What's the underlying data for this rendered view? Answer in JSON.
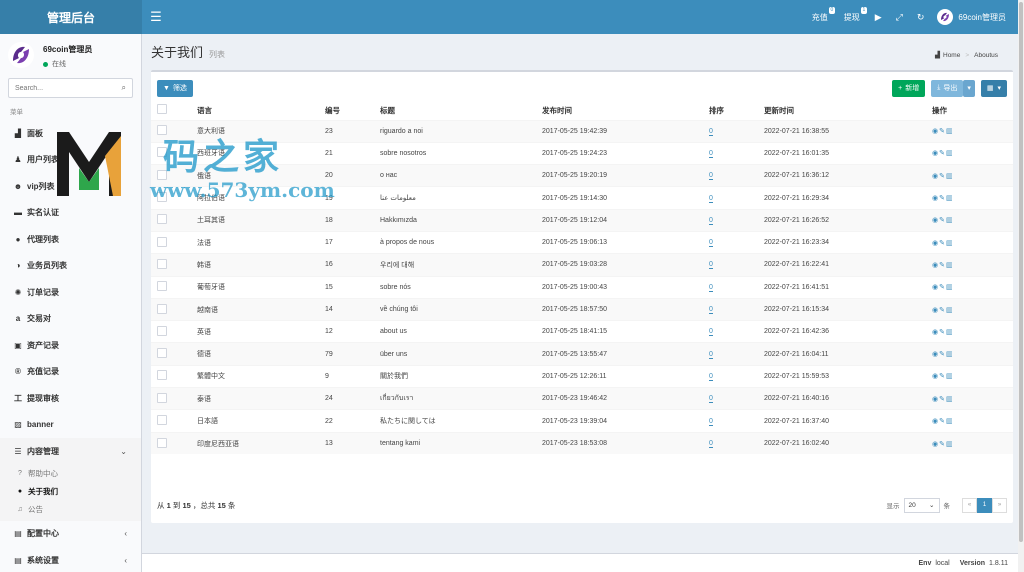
{
  "header": {
    "logo": "管理后台",
    "links": [
      {
        "label": "充值",
        "badge": "0"
      },
      {
        "label": "提现",
        "badge": "1"
      }
    ],
    "user": "69coin管理员"
  },
  "sidebar": {
    "user_name": "69coin管理员",
    "status": "在线",
    "search_placeholder": "Search...",
    "menu_header": "菜单",
    "items": [
      {
        "label": "面板",
        "icon": "▟"
      },
      {
        "label": "用户列表",
        "icon": "♟"
      },
      {
        "label": "vip列表",
        "icon": "☻"
      },
      {
        "label": "实名认证",
        "icon": "▬"
      },
      {
        "label": "代理列表",
        "icon": "●"
      },
      {
        "label": "业务员列表",
        "icon": "◑"
      },
      {
        "label": "订单记录",
        "icon": "✺"
      },
      {
        "label": "交易对",
        "icon": "a"
      },
      {
        "label": "资产记录",
        "icon": "▣"
      },
      {
        "label": "充值记录",
        "icon": "®"
      },
      {
        "label": "提现审核",
        "icon": "工"
      },
      {
        "label": "banner",
        "icon": "▨"
      }
    ],
    "content_mgmt": {
      "label": "内容管理",
      "icon": "☰",
      "subitems": [
        {
          "label": "帮助中心",
          "icon": "?"
        },
        {
          "label": "关于我们",
          "icon": "●"
        },
        {
          "label": "公告",
          "icon": "♫"
        }
      ]
    },
    "config_center": {
      "label": "配置中心",
      "icon": "▤"
    },
    "system_settings": {
      "label": "系统设置",
      "icon": "▤"
    }
  },
  "page": {
    "title": "关于我们",
    "subtitle": "列表",
    "breadcrumb_home": "Home",
    "breadcrumb_current": "Aboutus"
  },
  "toolbar": {
    "filter": "筛选",
    "add": "新增",
    "export": "导出"
  },
  "table": {
    "headers": [
      "语言",
      "编号",
      "标题",
      "发布时间",
      "排序",
      "更新时间",
      "操作"
    ],
    "rows": [
      {
        "lang": "意大利语",
        "id": "23",
        "title": "riguardo a noi",
        "published": "2017-05-25 19:42:39",
        "sort": "0",
        "updated": "2022-07-21 16:38:55"
      },
      {
        "lang": "西班牙语",
        "id": "21",
        "title": "sobre nosotros",
        "published": "2017-05-25 19:24:23",
        "sort": "0",
        "updated": "2022-07-21 16:01:35"
      },
      {
        "lang": "俄语",
        "id": "20",
        "title": "о нас",
        "published": "2017-05-25 19:20:19",
        "sort": "0",
        "updated": "2022-07-21 16:36:12"
      },
      {
        "lang": "阿拉伯语",
        "id": "19",
        "title": "معلومات عنا",
        "published": "2017-05-25 19:14:30",
        "sort": "0",
        "updated": "2022-07-21 16:29:34"
      },
      {
        "lang": "土耳其语",
        "id": "18",
        "title": "Hakkımızda",
        "published": "2017-05-25 19:12:04",
        "sort": "0",
        "updated": "2022-07-21 16:26:52"
      },
      {
        "lang": "法语",
        "id": "17",
        "title": "à propos de nous",
        "published": "2017-05-25 19:06:13",
        "sort": "0",
        "updated": "2022-07-21 16:23:34"
      },
      {
        "lang": "韩语",
        "id": "16",
        "title": "우리에 대해",
        "published": "2017-05-25 19:03:28",
        "sort": "0",
        "updated": "2022-07-21 16:22:41"
      },
      {
        "lang": "葡萄牙语",
        "id": "15",
        "title": "sobre nós",
        "published": "2017-05-25 19:00:43",
        "sort": "0",
        "updated": "2022-07-21 16:41:51"
      },
      {
        "lang": "越南语",
        "id": "14",
        "title": "về chúng tôi",
        "published": "2017-05-25 18:57:50",
        "sort": "0",
        "updated": "2022-07-21 16:15:34"
      },
      {
        "lang": "英语",
        "id": "12",
        "title": "about us",
        "published": "2017-05-25 18:41:15",
        "sort": "0",
        "updated": "2022-07-21 16:42:36"
      },
      {
        "lang": "德语",
        "id": "79",
        "title": "über uns",
        "published": "2017-05-25 13:55:47",
        "sort": "0",
        "updated": "2022-07-21 16:04:11"
      },
      {
        "lang": "繁體中文",
        "id": "9",
        "title": "關於我們",
        "published": "2017-05-25 12:26:11",
        "sort": "0",
        "updated": "2022-07-21 15:59:53"
      },
      {
        "lang": "泰语",
        "id": "24",
        "title": "เกี่ยวกับเรา",
        "published": "2017-05-23 19:46:42",
        "sort": "0",
        "updated": "2022-07-21 16:40:16"
      },
      {
        "lang": "日本語",
        "id": "22",
        "title": "私たちに関しては",
        "published": "2017-05-23 19:39:04",
        "sort": "0",
        "updated": "2022-07-21 16:37:40"
      },
      {
        "lang": "印度尼西亚语",
        "id": "13",
        "title": "tentang kami",
        "published": "2017-05-23 18:53:08",
        "sort": "0",
        "updated": "2022-07-21 16:02:40"
      }
    ]
  },
  "pager": {
    "summary_prefix": "从",
    "from": "1",
    "to_word": "到",
    "to": "15",
    "total_prefix": "，总共",
    "total": "15",
    "total_suffix": "条",
    "show_label": "显示",
    "page_size": "20",
    "per_label": "条",
    "prev": "«",
    "current": "1",
    "next": "»"
  },
  "footer": {
    "env_label": "Env",
    "env_value": "local",
    "version_label": "Version",
    "version_value": "1.8.11"
  },
  "watermark": {
    "text": "码之家",
    "url": "www.573ym.com"
  },
  "colors": {
    "primary": "#3c8dbc",
    "success": "#00a65a",
    "brand_purple": "#5b2c8c"
  }
}
